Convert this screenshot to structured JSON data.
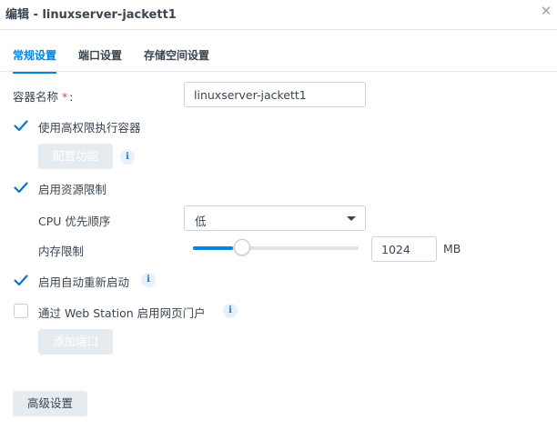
{
  "window": {
    "title": "编辑 - linuxserver-jackett1",
    "close_glyph": "✕"
  },
  "tabs": [
    {
      "label": "常规设置",
      "active": true
    },
    {
      "label": "端口设置",
      "active": false
    },
    {
      "label": "存储空间设置",
      "active": false
    }
  ],
  "form": {
    "container_name": {
      "label": "容器名称",
      "required_mark": "*",
      "colon": ":",
      "value": "linuxserver-jackett1"
    },
    "privileged": {
      "label": "使用高权限执行容器",
      "checked": true
    },
    "configure_button": {
      "label": "配置功能"
    },
    "resource_limit": {
      "label": "启用资源限制",
      "checked": true
    },
    "cpu_priority": {
      "label": "CPU 优先顺序",
      "value": "低"
    },
    "memory_limit": {
      "label": "内存限制",
      "value": "1024",
      "unit": "MB",
      "slider_fraction": 0.24
    },
    "auto_restart": {
      "label": "启用自动重新启动",
      "checked": true
    },
    "web_station": {
      "label": "通过 Web Station 启用网页门户",
      "checked": false
    },
    "add_port_button": {
      "label": "添加端口"
    },
    "advanced_button": {
      "label": "高级设置"
    }
  },
  "icons": {
    "info": "i"
  },
  "colors": {
    "accent": "#0086e5",
    "required": "#e64545"
  }
}
